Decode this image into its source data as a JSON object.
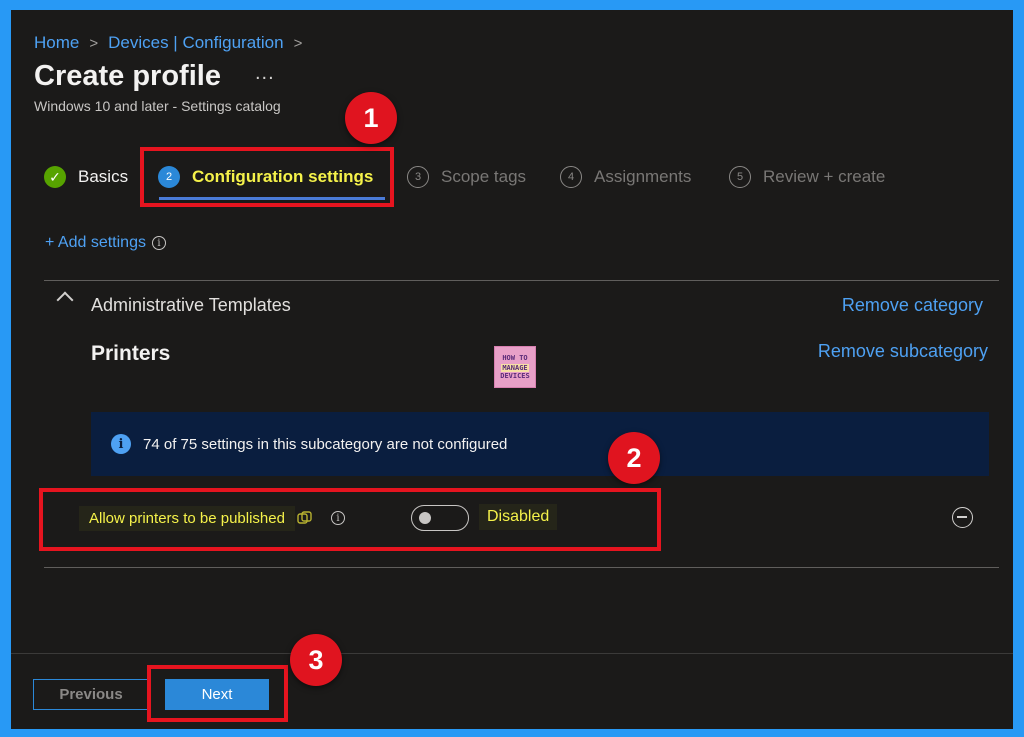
{
  "breadcrumb": {
    "home": "Home",
    "devices": "Devices | Configuration",
    "sep": ">"
  },
  "page": {
    "title": "Create profile",
    "more": "...",
    "subtitle": "Windows 10 and later - Settings catalog"
  },
  "steps": [
    {
      "num": "✓",
      "label": "Basics",
      "state": "done"
    },
    {
      "num": "2",
      "label": "Configuration settings",
      "state": "active"
    },
    {
      "num": "3",
      "label": "Scope tags",
      "state": "todo"
    },
    {
      "num": "4",
      "label": "Assignments",
      "state": "todo"
    },
    {
      "num": "5",
      "label": "Review + create",
      "state": "todo"
    }
  ],
  "add_settings": "+ Add settings",
  "category": {
    "label": "Administrative Templates",
    "remove": "Remove category"
  },
  "subcategory": {
    "label": "Printers",
    "remove": "Remove subcategory"
  },
  "logo": {
    "line1": "HOW TO",
    "line2": "MANAGE",
    "line3": "DEVICES"
  },
  "info_bar": {
    "text": "74 of 75 settings in this subcategory are not configured"
  },
  "setting": {
    "name": "Allow printers to be published",
    "toggle_on": false,
    "state": "Disabled"
  },
  "callouts": [
    "1",
    "2",
    "3"
  ],
  "footer": {
    "previous": "Previous",
    "next": "Next"
  },
  "colors": {
    "border": "#2899f5",
    "background": "#1b1a19",
    "accent": "#2b88d8",
    "link": "#4ea1f3",
    "highlight": "#e6141f"
  }
}
